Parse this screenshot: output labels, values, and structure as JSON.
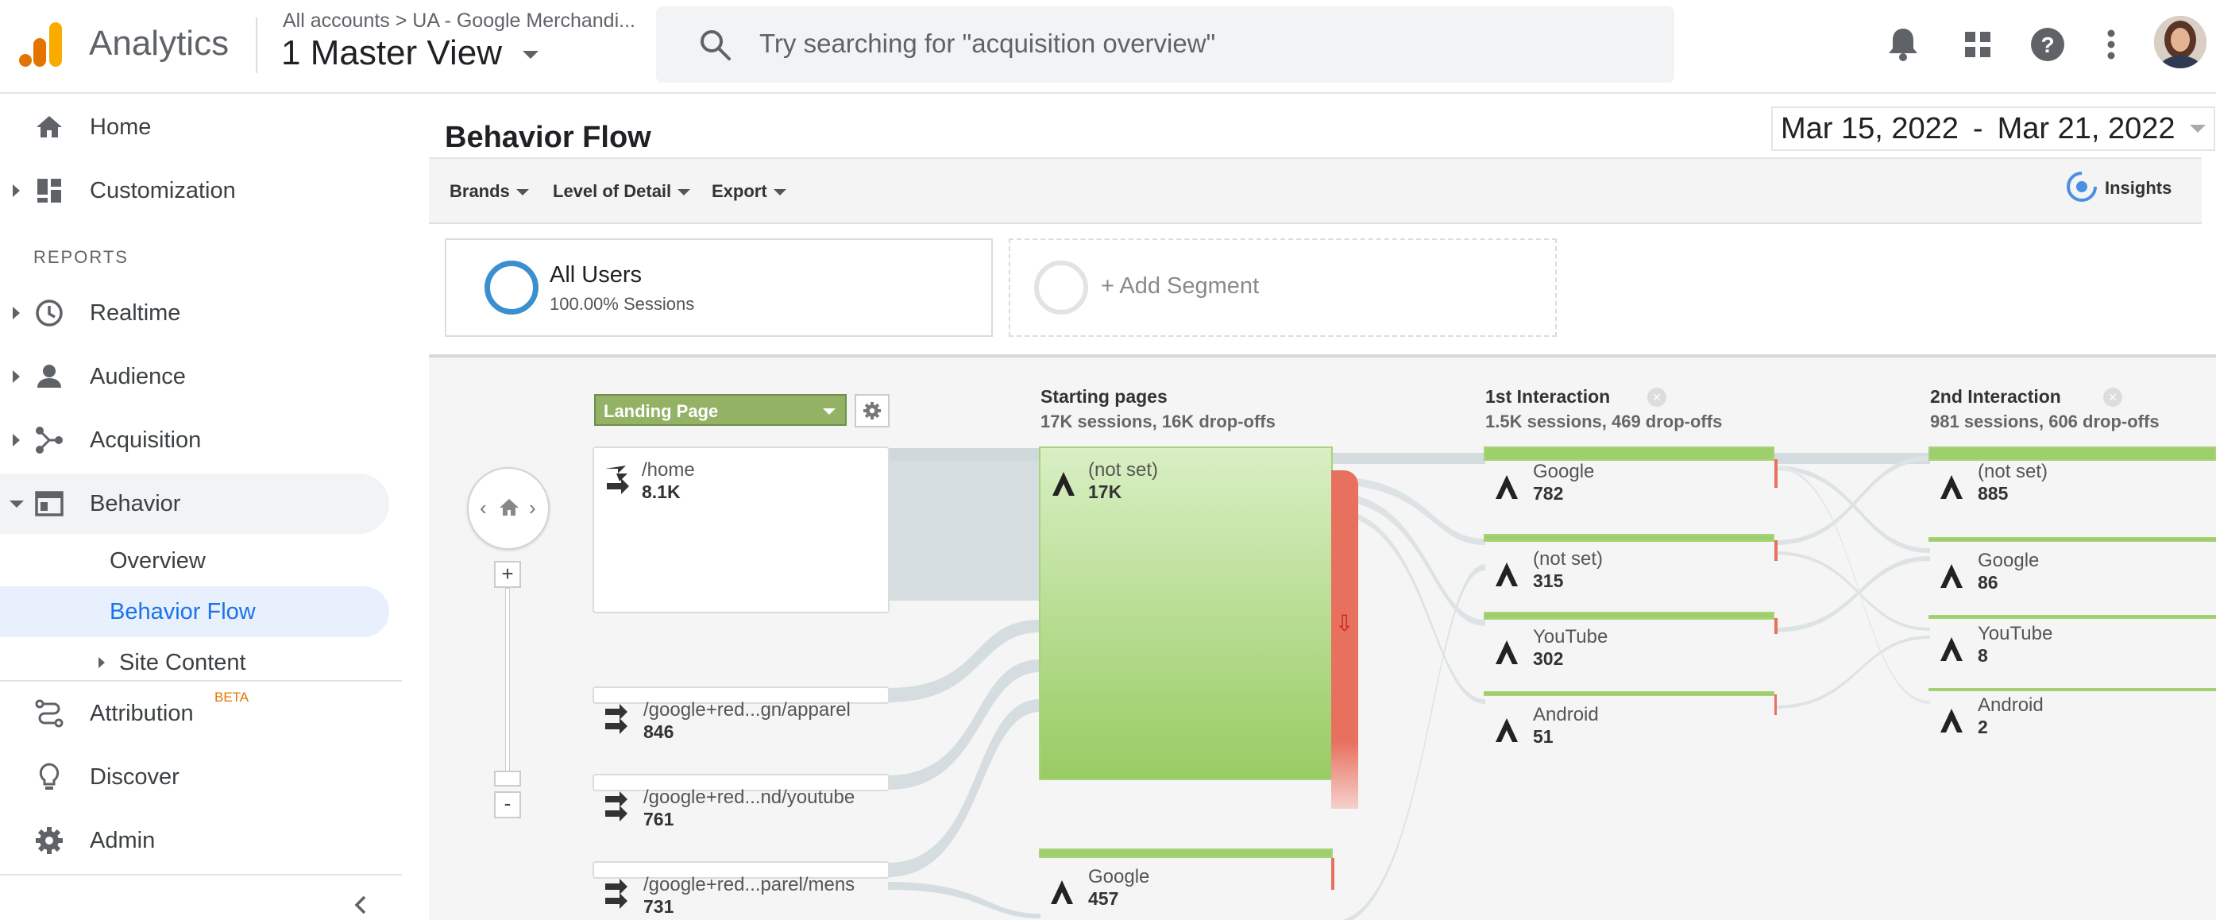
{
  "header": {
    "app_name": "Analytics",
    "breadcrumb": "All accounts > UA - Google Merchandi...",
    "view_name": "1 Master View",
    "search_placeholder": "Try searching for \"acquisition overview\""
  },
  "sidebar": {
    "items": [
      {
        "label": "Home"
      },
      {
        "label": "Customization"
      },
      {
        "label": "Realtime"
      },
      {
        "label": "Audience"
      },
      {
        "label": "Acquisition"
      },
      {
        "label": "Behavior"
      },
      {
        "label": "Attribution"
      },
      {
        "label": "Discover"
      },
      {
        "label": "Admin"
      }
    ],
    "reports_label": "REPORTS",
    "behavior_sub": [
      "Overview",
      "Behavior Flow",
      "Site Content"
    ],
    "attribution_badge": "BETA"
  },
  "page": {
    "title": "Behavior Flow",
    "date_start": "Mar 15, 2022",
    "date_sep": "-",
    "date_end": "Mar 21, 2022",
    "toolbar": {
      "brands": "Brands",
      "level": "Level of Detail",
      "export": "Export",
      "insights": "Insights"
    }
  },
  "segments": {
    "all_users": "All Users",
    "all_users_sub": "100.00% Sessions",
    "add_segment": "+ Add Segment"
  },
  "flow": {
    "dimension": "Landing Page",
    "landing": [
      {
        "label": "/home",
        "value": "8.1K"
      },
      {
        "label": "/google+red...gn/apparel",
        "value": "846"
      },
      {
        "label": "/google+red...nd/youtube",
        "value": "761"
      },
      {
        "label": "/google+red...parel/mens",
        "value": "731"
      }
    ],
    "starting": {
      "title": "Starting pages",
      "sub": "17K sessions, 16K drop-offs",
      "nodes": [
        {
          "label": "(not set)",
          "value": "17K"
        },
        {
          "label": "Google",
          "value": "457"
        }
      ]
    },
    "first": {
      "title": "1st Interaction",
      "sub": "1.5K sessions, 469 drop-offs",
      "nodes": [
        {
          "label": "Google",
          "value": "782"
        },
        {
          "label": "(not set)",
          "value": "315"
        },
        {
          "label": "YouTube",
          "value": "302"
        },
        {
          "label": "Android",
          "value": "51"
        }
      ]
    },
    "second": {
      "title": "2nd Interaction",
      "sub": "981 sessions, 606 drop-offs",
      "nodes": [
        {
          "label": "(not set)",
          "value": "885"
        },
        {
          "label": "Google",
          "value": "86"
        },
        {
          "label": "YouTube",
          "value": "8"
        },
        {
          "label": "Android",
          "value": "2"
        }
      ]
    }
  },
  "colors": {
    "accent": "#1a73e8",
    "selected_bg": "#e8f0fe",
    "node_green": "#8fca5a",
    "dropoff_red": "#e8705f",
    "logo_orange": "#f9ab00",
    "logo_dark": "#e37400"
  }
}
